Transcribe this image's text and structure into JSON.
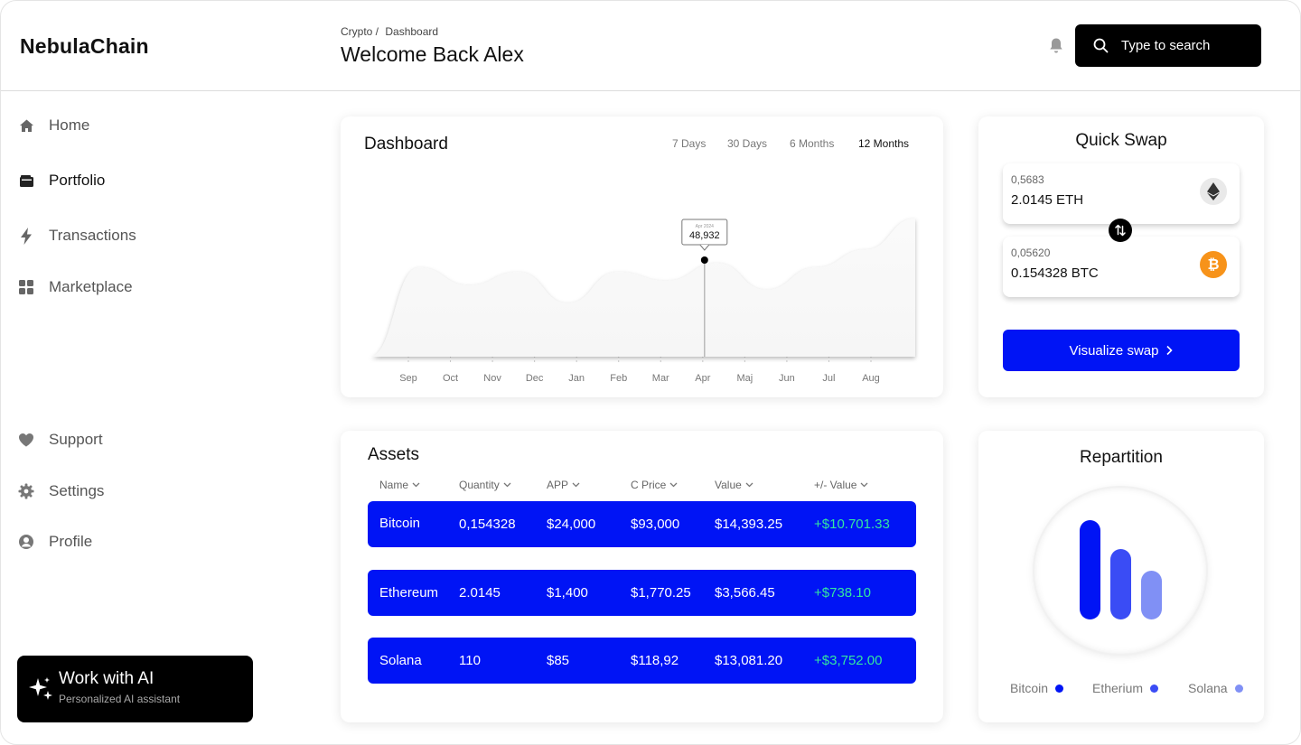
{
  "app": {
    "name": "NebulaChain"
  },
  "header": {
    "breadcrumb": [
      "Crypto /",
      "Dashboard"
    ],
    "welcome": "Welcome Back Alex",
    "search_placeholder": "Type to search"
  },
  "sidebar": {
    "items": [
      {
        "label": "Home",
        "icon": "home-icon",
        "active": false
      },
      {
        "label": "Portfolio",
        "icon": "wallet-icon",
        "active": true
      },
      {
        "label": "Transactions",
        "icon": "lightning-icon",
        "active": false
      },
      {
        "label": "Marketplace",
        "icon": "grid-icon",
        "active": false
      }
    ],
    "bottom_items": [
      {
        "label": "Support",
        "icon": "heart-icon"
      },
      {
        "label": "Settings",
        "icon": "gear-icon"
      },
      {
        "label": "Profile",
        "icon": "user-circle-icon"
      }
    ],
    "ai_card": {
      "title": "Work with AI",
      "subtitle": "Personalized AI assistant",
      "icon": "sparkles-icon"
    }
  },
  "dashboard": {
    "title": "Dashboard",
    "ranges": [
      "7 Days",
      "30 Days",
      "6 Months",
      "12 Months"
    ],
    "active_range": "12 Months",
    "tooltip": {
      "label": "Apr 2024",
      "value": "48,932"
    }
  },
  "chart_data": {
    "type": "area",
    "title": "Dashboard",
    "categories": [
      "Sep",
      "Oct",
      "Nov",
      "Dec",
      "Jan",
      "Feb",
      "Mar",
      "Apr",
      "Maj",
      "Jun",
      "Jul",
      "Aug"
    ],
    "series": [
      {
        "values": [
          0,
          100,
          80,
          95,
          60,
          95,
          85,
          105,
          75,
          100,
          120,
          155
        ]
      }
    ],
    "highlight": {
      "category": "Apr",
      "value": "48,932"
    },
    "grid": false
  },
  "quick_swap": {
    "title": "Quick Swap",
    "from": {
      "sub": "0,5683",
      "amount": "2.0145 ETH",
      "icon": "ethereum-icon"
    },
    "to": {
      "sub": "0,05620",
      "amount": "0.154328 BTC",
      "icon": "bitcoin-icon"
    },
    "swap_icon": "swap-arrows-icon",
    "button": "Visualize swap"
  },
  "assets": {
    "title": "Assets",
    "columns": [
      "Name",
      "Quantity",
      "APP",
      "C Price",
      "Value",
      "+/- Value"
    ],
    "rows": [
      {
        "name": "Bitcoin",
        "quantity": "0,154328",
        "app": "$24,000",
        "cprice": "$93,000",
        "value": "$14,393.25",
        "change": "+$10.701.33"
      },
      {
        "name": "Ethereum",
        "quantity": "2.0145",
        "app": "$1,400",
        "cprice": "$1,770.25",
        "value": "$3,566.45",
        "change": "+$738.10"
      },
      {
        "name": "Solana",
        "quantity": "110",
        "app": "$85",
        "cprice": "$118,92",
        "value": "$13,081.20",
        "change": "+$3,752.00"
      }
    ]
  },
  "repartition": {
    "title": "Repartition",
    "legend": [
      {
        "label": "Bitcoin",
        "color": "#0014f5",
        "share": 1.0
      },
      {
        "label": "Etherium",
        "color": "#3a4cf5",
        "share": 0.71
      },
      {
        "label": "Solana",
        "color": "#8090f5",
        "share": 0.49
      }
    ]
  },
  "colors": {
    "accent": "#0014f5",
    "positive": "#33e6a0",
    "dark": "#000000"
  }
}
